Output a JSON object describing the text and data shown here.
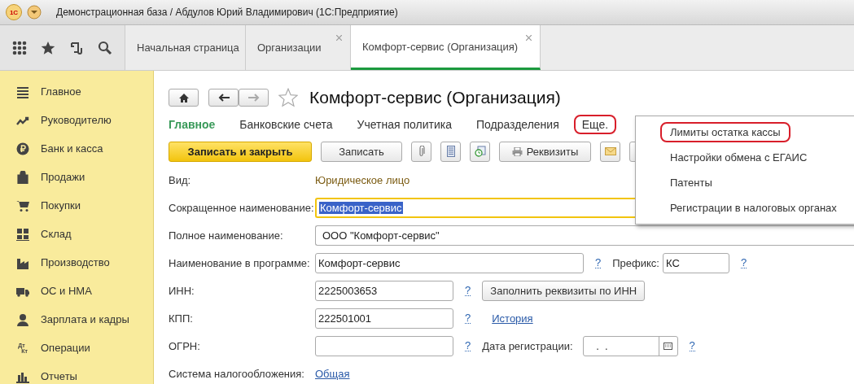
{
  "window": {
    "title": "Демонстрационная база / Абдулов Юрий Владимирович  (1С:Предприятие)",
    "logo": "1С"
  },
  "tabs": [
    {
      "label": "Начальная страница",
      "selected": false,
      "closable": false
    },
    {
      "label": "Организации",
      "selected": false,
      "closable": true
    },
    {
      "label": "Комфорт-сервис (Организация)",
      "selected": true,
      "closable": true
    }
  ],
  "sidebar": {
    "items": [
      {
        "label": "Главное"
      },
      {
        "label": "Руководителю"
      },
      {
        "label": "Банк и касса"
      },
      {
        "label": "Продажи"
      },
      {
        "label": "Покупки"
      },
      {
        "label": "Склад"
      },
      {
        "label": "Производство"
      },
      {
        "label": "ОС и НМА"
      },
      {
        "label": "Зарплата и кадры"
      },
      {
        "label": "Операции",
        "icon_text": [
          "Дт",
          "Кт"
        ]
      },
      {
        "label": "Отчеты"
      }
    ]
  },
  "form": {
    "title": "Комфорт-сервис (Организация)",
    "sections": [
      {
        "label": "Главное",
        "selected": true,
        "highlighted": false
      },
      {
        "label": "Банковские счета",
        "selected": false,
        "highlighted": false
      },
      {
        "label": "Учетная политика",
        "selected": false,
        "highlighted": false
      },
      {
        "label": "Подразделения",
        "selected": false,
        "highlighted": false
      },
      {
        "label": "Еще.",
        "selected": false,
        "highlighted": true
      }
    ],
    "toolbar": {
      "primary": "Записать и закрыть",
      "save": "Записать",
      "details": "Реквизиты"
    },
    "kind_label": "Вид:",
    "kind_value": "Юридическое лицо",
    "short_name": {
      "label": "Сокращенное наименование:",
      "value": "Комфорт-сервис"
    },
    "full_name": {
      "label": "Полное наименование:",
      "value": "ООО \"Комфорт-сервис\""
    },
    "program_name": {
      "label": "Наименование в программе:",
      "value": "Комфорт-сервис",
      "help": "?"
    },
    "prefix": {
      "label": "Префикс:",
      "value": "КС",
      "help": "?"
    },
    "inn": {
      "label": "ИНН:",
      "value": "2225003653",
      "help": "?",
      "button": "Заполнить реквизиты по ИНН"
    },
    "kpp": {
      "label": "КПП:",
      "value": "222501001",
      "help": "?",
      "link": "История"
    },
    "ogrn": {
      "label": "ОГРН:",
      "help": "?"
    },
    "reg_date": {
      "label": "Дата регистрации:",
      "value": " .  .",
      "help": "?"
    },
    "tax": {
      "label": "Система налогообложения:",
      "link": "Общая"
    }
  },
  "more_menu": {
    "items": [
      {
        "label": "Лимиты остатка кассы",
        "highlighted": true
      },
      {
        "label": "Настройки обмена с ЕГАИС",
        "highlighted": false
      },
      {
        "label": "Патенты",
        "highlighted": false
      },
      {
        "label": "Регистрации в налоговых органах",
        "highlighted": false
      }
    ]
  }
}
